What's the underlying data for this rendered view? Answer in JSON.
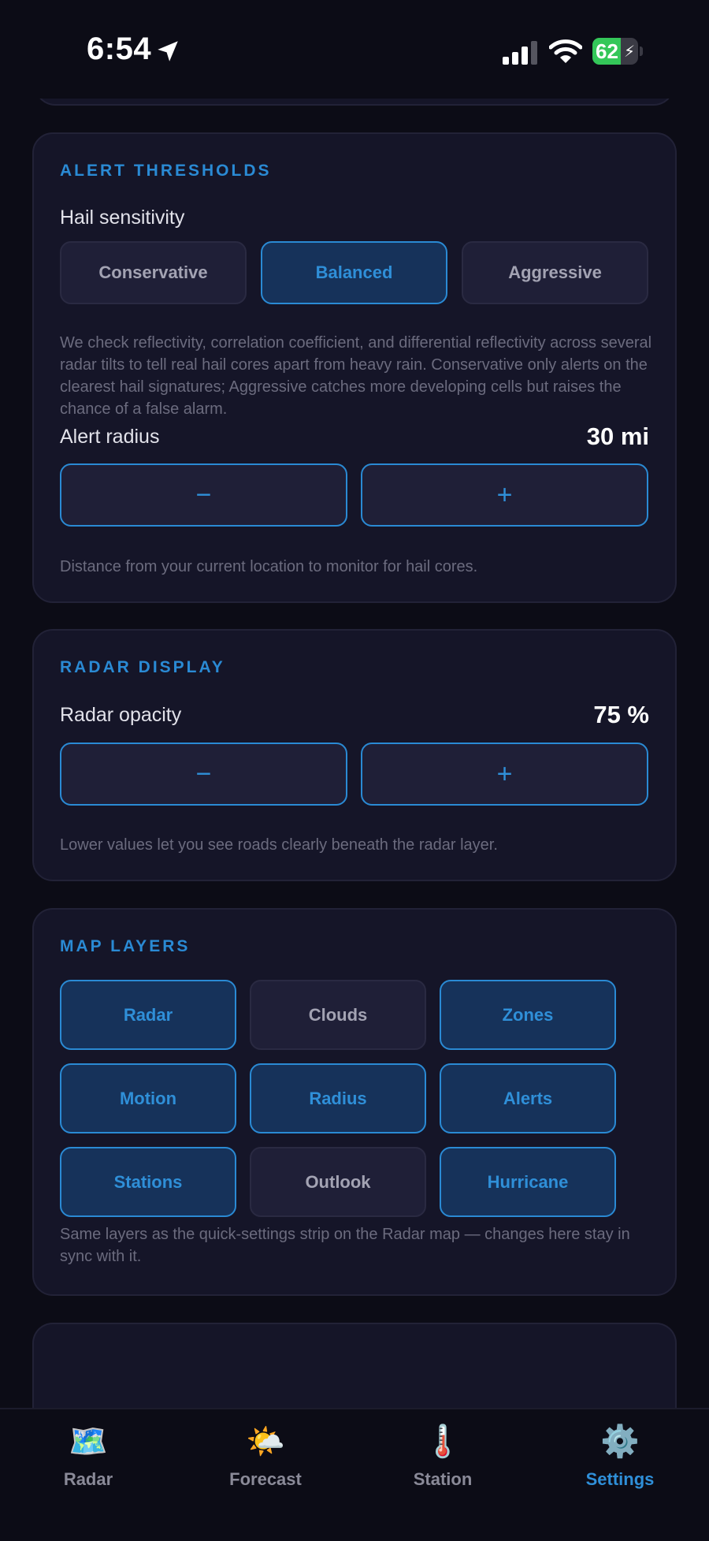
{
  "status_bar": {
    "time": "6:54",
    "battery": "62",
    "battery_level_percent": 62
  },
  "alert_thresholds": {
    "title": "ALERT THRESHOLDS",
    "hail_label": "Hail sensitivity",
    "options": [
      {
        "label": "Conservative",
        "selected": false
      },
      {
        "label": "Balanced",
        "selected": true
      },
      {
        "label": "Aggressive",
        "selected": false
      }
    ],
    "hail_description": "We check reflectivity, correlation coefficient, and differential reflectivity across several radar tilts to tell real hail cores apart from heavy rain. Conservative only alerts on the clearest hail signatures; Aggressive catches more developing cells but raises the chance of a false alarm.",
    "radius_label": "Alert radius",
    "radius_value": "30 mi",
    "minus": "−",
    "plus": "+",
    "radius_description": "Distance from your current location to monitor for hail cores."
  },
  "radar_display": {
    "title": "RADAR DISPLAY",
    "opacity_label": "Radar opacity",
    "opacity_value": "75 %",
    "minus": "−",
    "plus": "+",
    "description": "Lower values let you see roads clearly beneath the radar layer."
  },
  "map_layers": {
    "title": "MAP LAYERS",
    "layers": [
      {
        "label": "Radar",
        "enabled": true
      },
      {
        "label": "Clouds",
        "enabled": false
      },
      {
        "label": "Zones",
        "enabled": true
      },
      {
        "label": "Motion",
        "enabled": true
      },
      {
        "label": "Radius",
        "enabled": true
      },
      {
        "label": "Alerts",
        "enabled": true
      },
      {
        "label": "Stations",
        "enabled": true
      },
      {
        "label": "Outlook",
        "enabled": false
      },
      {
        "label": "Hurricane",
        "enabled": true
      }
    ],
    "description": "Same layers as the quick-settings strip on the Radar map — changes here stay in sync with it."
  },
  "tab_bar": {
    "tabs": [
      {
        "label": "Radar",
        "icon": "🗺️",
        "icon_name": "map-icon",
        "active": false
      },
      {
        "label": "Forecast",
        "icon": "🌤️",
        "icon_name": "sun-cloud-icon",
        "active": false
      },
      {
        "label": "Station",
        "icon": "🌡️",
        "icon_name": "thermometer-icon",
        "active": false
      },
      {
        "label": "Settings",
        "icon": "⚙️",
        "icon_name": "gear-icon",
        "active": true
      }
    ]
  },
  "colors": {
    "accent": "#2a8ad4",
    "background": "#0c0c16",
    "card": "#151528"
  }
}
